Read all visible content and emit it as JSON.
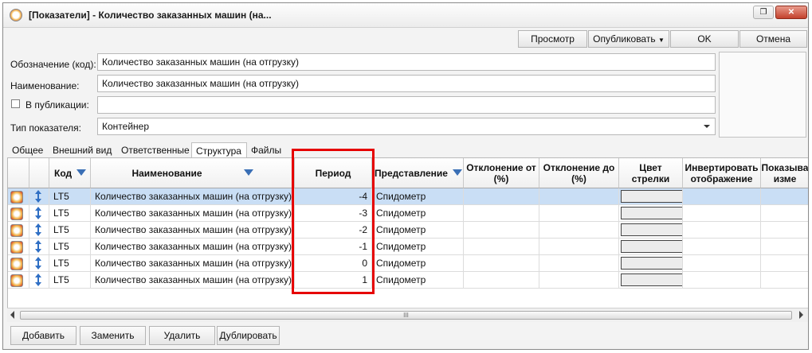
{
  "window": {
    "title": "[Показатели] - Количество заказанных машин (на..."
  },
  "toolbar": {
    "preview": "Просмотр",
    "publish": "Опубликовать",
    "ok": "OK",
    "cancel": "Отмена"
  },
  "form": {
    "code_label": "Обозначение (код):",
    "code_value": "Количество заказанных машин (на отгрузку)",
    "name_label": "Наименование:",
    "name_value": "Количество заказанных машин (на отгрузку)",
    "publication_label": "В публикации:",
    "publication_value": "",
    "type_label": "Тип показателя:",
    "type_value": "Контейнер"
  },
  "tabs": [
    "Общее",
    "Внешний вид",
    "Ответственные",
    "Структура",
    "Файлы"
  ],
  "active_tab": "Структура",
  "grid": {
    "columns": {
      "code": "Код",
      "name": "Наименование",
      "period": "Период",
      "view": "Представление",
      "dev_from": "Отклонение от (%)",
      "dev_to": "Отклонение до (%)",
      "arrow_color": "Цвет стрелки",
      "invert": "Инвертировать отображение",
      "show": "Показыва изме"
    },
    "rows": [
      {
        "code": "LT5",
        "name": "Количество заказанных машин (на отгрузку)",
        "period": "-4",
        "view": "Спидометр",
        "selected": true
      },
      {
        "code": "LT5",
        "name": "Количество заказанных машин (на отгрузку)",
        "period": "-3",
        "view": "Спидометр",
        "selected": false
      },
      {
        "code": "LT5",
        "name": "Количество заказанных машин (на отгрузку)",
        "period": "-2",
        "view": "Спидометр",
        "selected": false
      },
      {
        "code": "LT5",
        "name": "Количество заказанных машин (на отгрузку)",
        "period": "-1",
        "view": "Спидометр",
        "selected": false
      },
      {
        "code": "LT5",
        "name": "Количество заказанных машин (на отгрузку)",
        "period": "0",
        "view": "Спидометр",
        "selected": false
      },
      {
        "code": "LT5",
        "name": "Количество заказанных машин (на отгрузку)",
        "period": "1",
        "view": "Спидометр",
        "selected": false
      }
    ]
  },
  "scrollbar": {
    "grip": "III"
  },
  "actions": {
    "add": "Добавить",
    "replace": "Заменить",
    "delete": "Удалить",
    "duplicate": "Дублировать"
  },
  "colors": {
    "highlight": "#e60000",
    "selected_row": "#c9def5",
    "filter_icon": "#3a6fb5"
  }
}
